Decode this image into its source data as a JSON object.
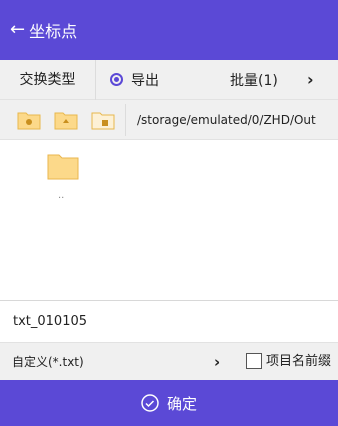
{
  "header": {
    "title": "坐标点",
    "back_icon": "arrow-left-icon"
  },
  "exchange": {
    "type_label": "交换类型",
    "mode_label": "导出",
    "mode_selected": true,
    "batch_label": "批量(1)"
  },
  "path": {
    "current": "/storage/emulated/0/ZHD/Out",
    "buttons": [
      "folder-home-icon",
      "folder-up-icon",
      "folder-device-icon"
    ]
  },
  "files": [
    {
      "name": "..",
      "icon": "folder-icon"
    }
  ],
  "filename": {
    "value": "txt_010105"
  },
  "format": {
    "label": "自定义(*.txt)",
    "prefix_label": "项目名前缀",
    "prefix_checked": false
  },
  "confirm": {
    "label": "确定"
  },
  "colors": {
    "accent": "#5b49d6",
    "folder": "#fcd98a"
  }
}
